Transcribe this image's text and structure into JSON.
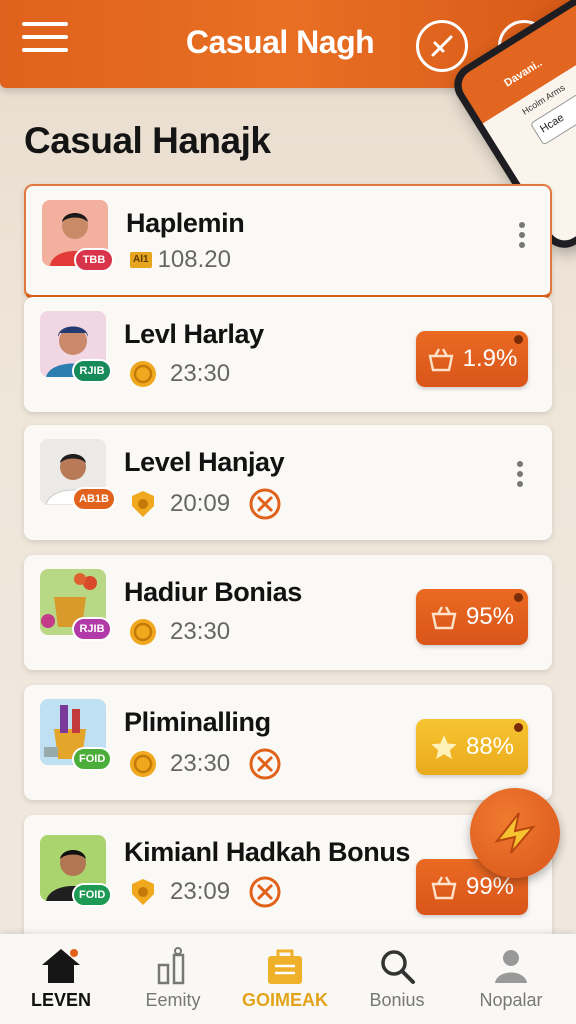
{
  "header": {
    "title": "Casual Nagh"
  },
  "phone_preview": {
    "title": "Davani..",
    "tag": "Hcolm  Arms",
    "box": "Hcae"
  },
  "section": {
    "title": "Casual Hanajk"
  },
  "cards": [
    {
      "title": "Haplemin",
      "badge": "TBB",
      "badge_color": "#d9354a",
      "chip": "Al1",
      "value": "108.20",
      "active": true,
      "action": "menu"
    },
    {
      "title": "Levl Harlay",
      "badge": "RJIB",
      "badge_color": "#178a5a",
      "value": "23:30",
      "bonus": "1.9%",
      "bonus_style": "orange"
    },
    {
      "title": "Level Hanjay",
      "badge": "AB1B",
      "badge_color": "#e0621c",
      "value": "20:09",
      "cancel": true,
      "action": "menu"
    },
    {
      "title": "Hadiur Bonias",
      "badge": "RJIB",
      "badge_color": "#b23aa8",
      "value": "23:30",
      "bonus": "95%",
      "bonus_style": "orange"
    },
    {
      "title": "Pliminalling",
      "badge": "FOID",
      "badge_color": "#4cae3a",
      "value": "23:30",
      "cancel": true,
      "bonus": "88%",
      "bonus_style": "gold"
    },
    {
      "title": "Kimianl Hadkah Bonus",
      "badge": "FOID",
      "badge_color": "#1f9a55",
      "value": "23:09",
      "cancel": true,
      "bonus": "99%",
      "bonus_style": "orange"
    }
  ],
  "nav": [
    {
      "label": "LEVEN",
      "icon": "home-icon",
      "state": "active"
    },
    {
      "label": "Eemity",
      "icon": "chart-icon"
    },
    {
      "label": "GOIMEAK",
      "icon": "bag-icon",
      "state": "gold"
    },
    {
      "label": "Bonius",
      "icon": "search-icon"
    },
    {
      "label": "Nopalar",
      "icon": "user-icon"
    }
  ]
}
